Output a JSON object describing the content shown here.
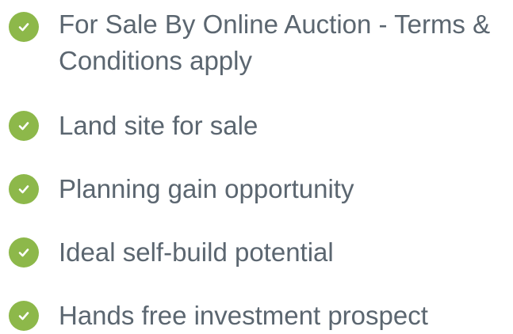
{
  "features": {
    "icon": "check-circle-icon",
    "icon_color": "#8db84a",
    "text_color": "#5b6670",
    "items": [
      {
        "label": "For Sale By Online Auction - Terms & Conditions apply"
      },
      {
        "label": "Land site for sale"
      },
      {
        "label": "Planning gain opportunity"
      },
      {
        "label": "Ideal self-build potential"
      },
      {
        "label": "Hands free investment prospect"
      }
    ]
  }
}
